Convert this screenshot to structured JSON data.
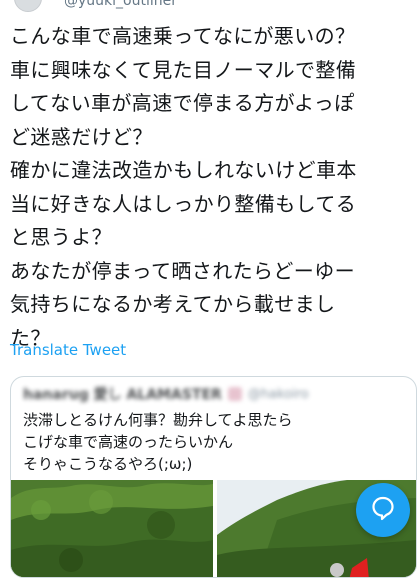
{
  "tweet": {
    "author_handle_partial": "@yuuki_outliner",
    "text": "こんな車で高速乗ってなにが悪いの？\n車に興味なくて見た目ノーマルで整備\nしてない車が高速で停まる方がよっぽ\nど迷惑だけど？\n確かに違法改造かもしれないけど車本\n当に好きな人はしっかり整備もしてる\nと思うよ？\nあなたが停まって晒されたらどーゆー\n気持ちになるか考えてから載せまし\nた？",
    "translate_label": "Translate Tweet"
  },
  "quote": {
    "author_name": "hanarug 愛し ALAMASTER",
    "author_handle": "@hakoiro",
    "text": "渋滞しとるけん何事？勘弁してよ思たら\nこげな車で高速のったらいかん\nそりゃこうなるやろ(;ω;)"
  },
  "icons": {
    "fab": "compose-reply-icon"
  },
  "colors": {
    "accent": "#1da1f2",
    "text": "#14171a",
    "secondary": "#657786",
    "border": "#cfd9de"
  }
}
